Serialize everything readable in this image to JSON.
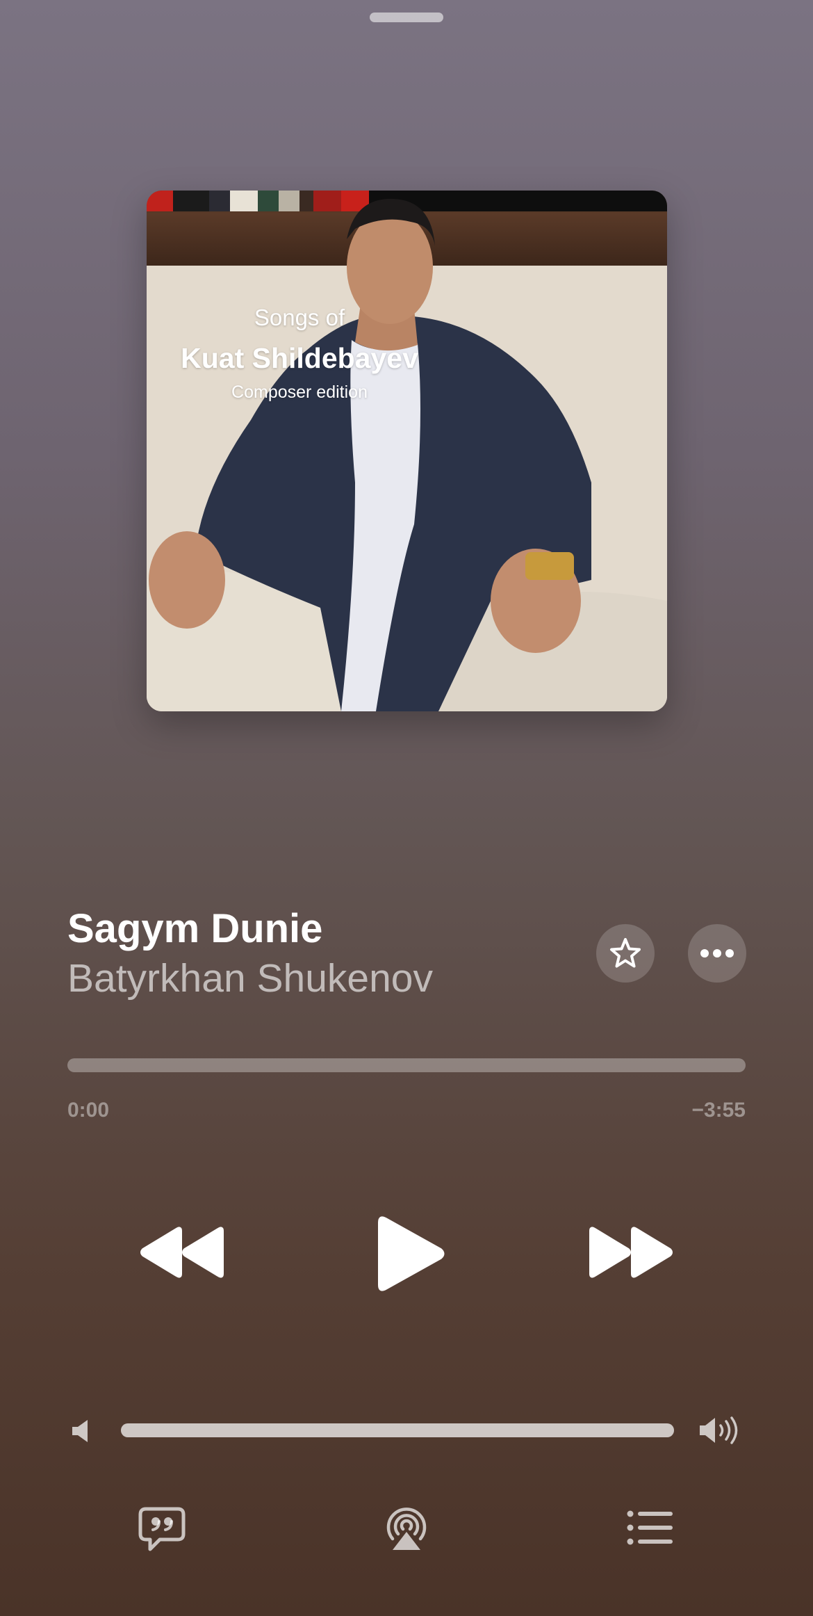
{
  "artwork": {
    "line1": "Songs of",
    "line2": "Kuat Shildebayev",
    "line3": "Composer edition"
  },
  "now_playing": {
    "title": "Sagym Dunie",
    "artist": "Batyrkhan Shukenov"
  },
  "progress": {
    "elapsed": "0:00",
    "remaining": "−3:55",
    "fraction": 0
  },
  "volume": {
    "level": 1.0
  },
  "icons": {
    "favorite": "star-icon",
    "more": "ellipsis-icon",
    "rewind": "rewind-icon",
    "play": "play-icon",
    "forward": "fast-forward-icon",
    "volume_low": "speaker-low-icon",
    "volume_high": "speaker-high-icon",
    "lyrics": "lyrics-quote-bubble-icon",
    "airplay": "airplay-icon",
    "queue": "list-icon"
  },
  "colors": {
    "bg_top": "#7b7382",
    "bg_bottom": "#4a3328",
    "controls": "#ffffff"
  }
}
